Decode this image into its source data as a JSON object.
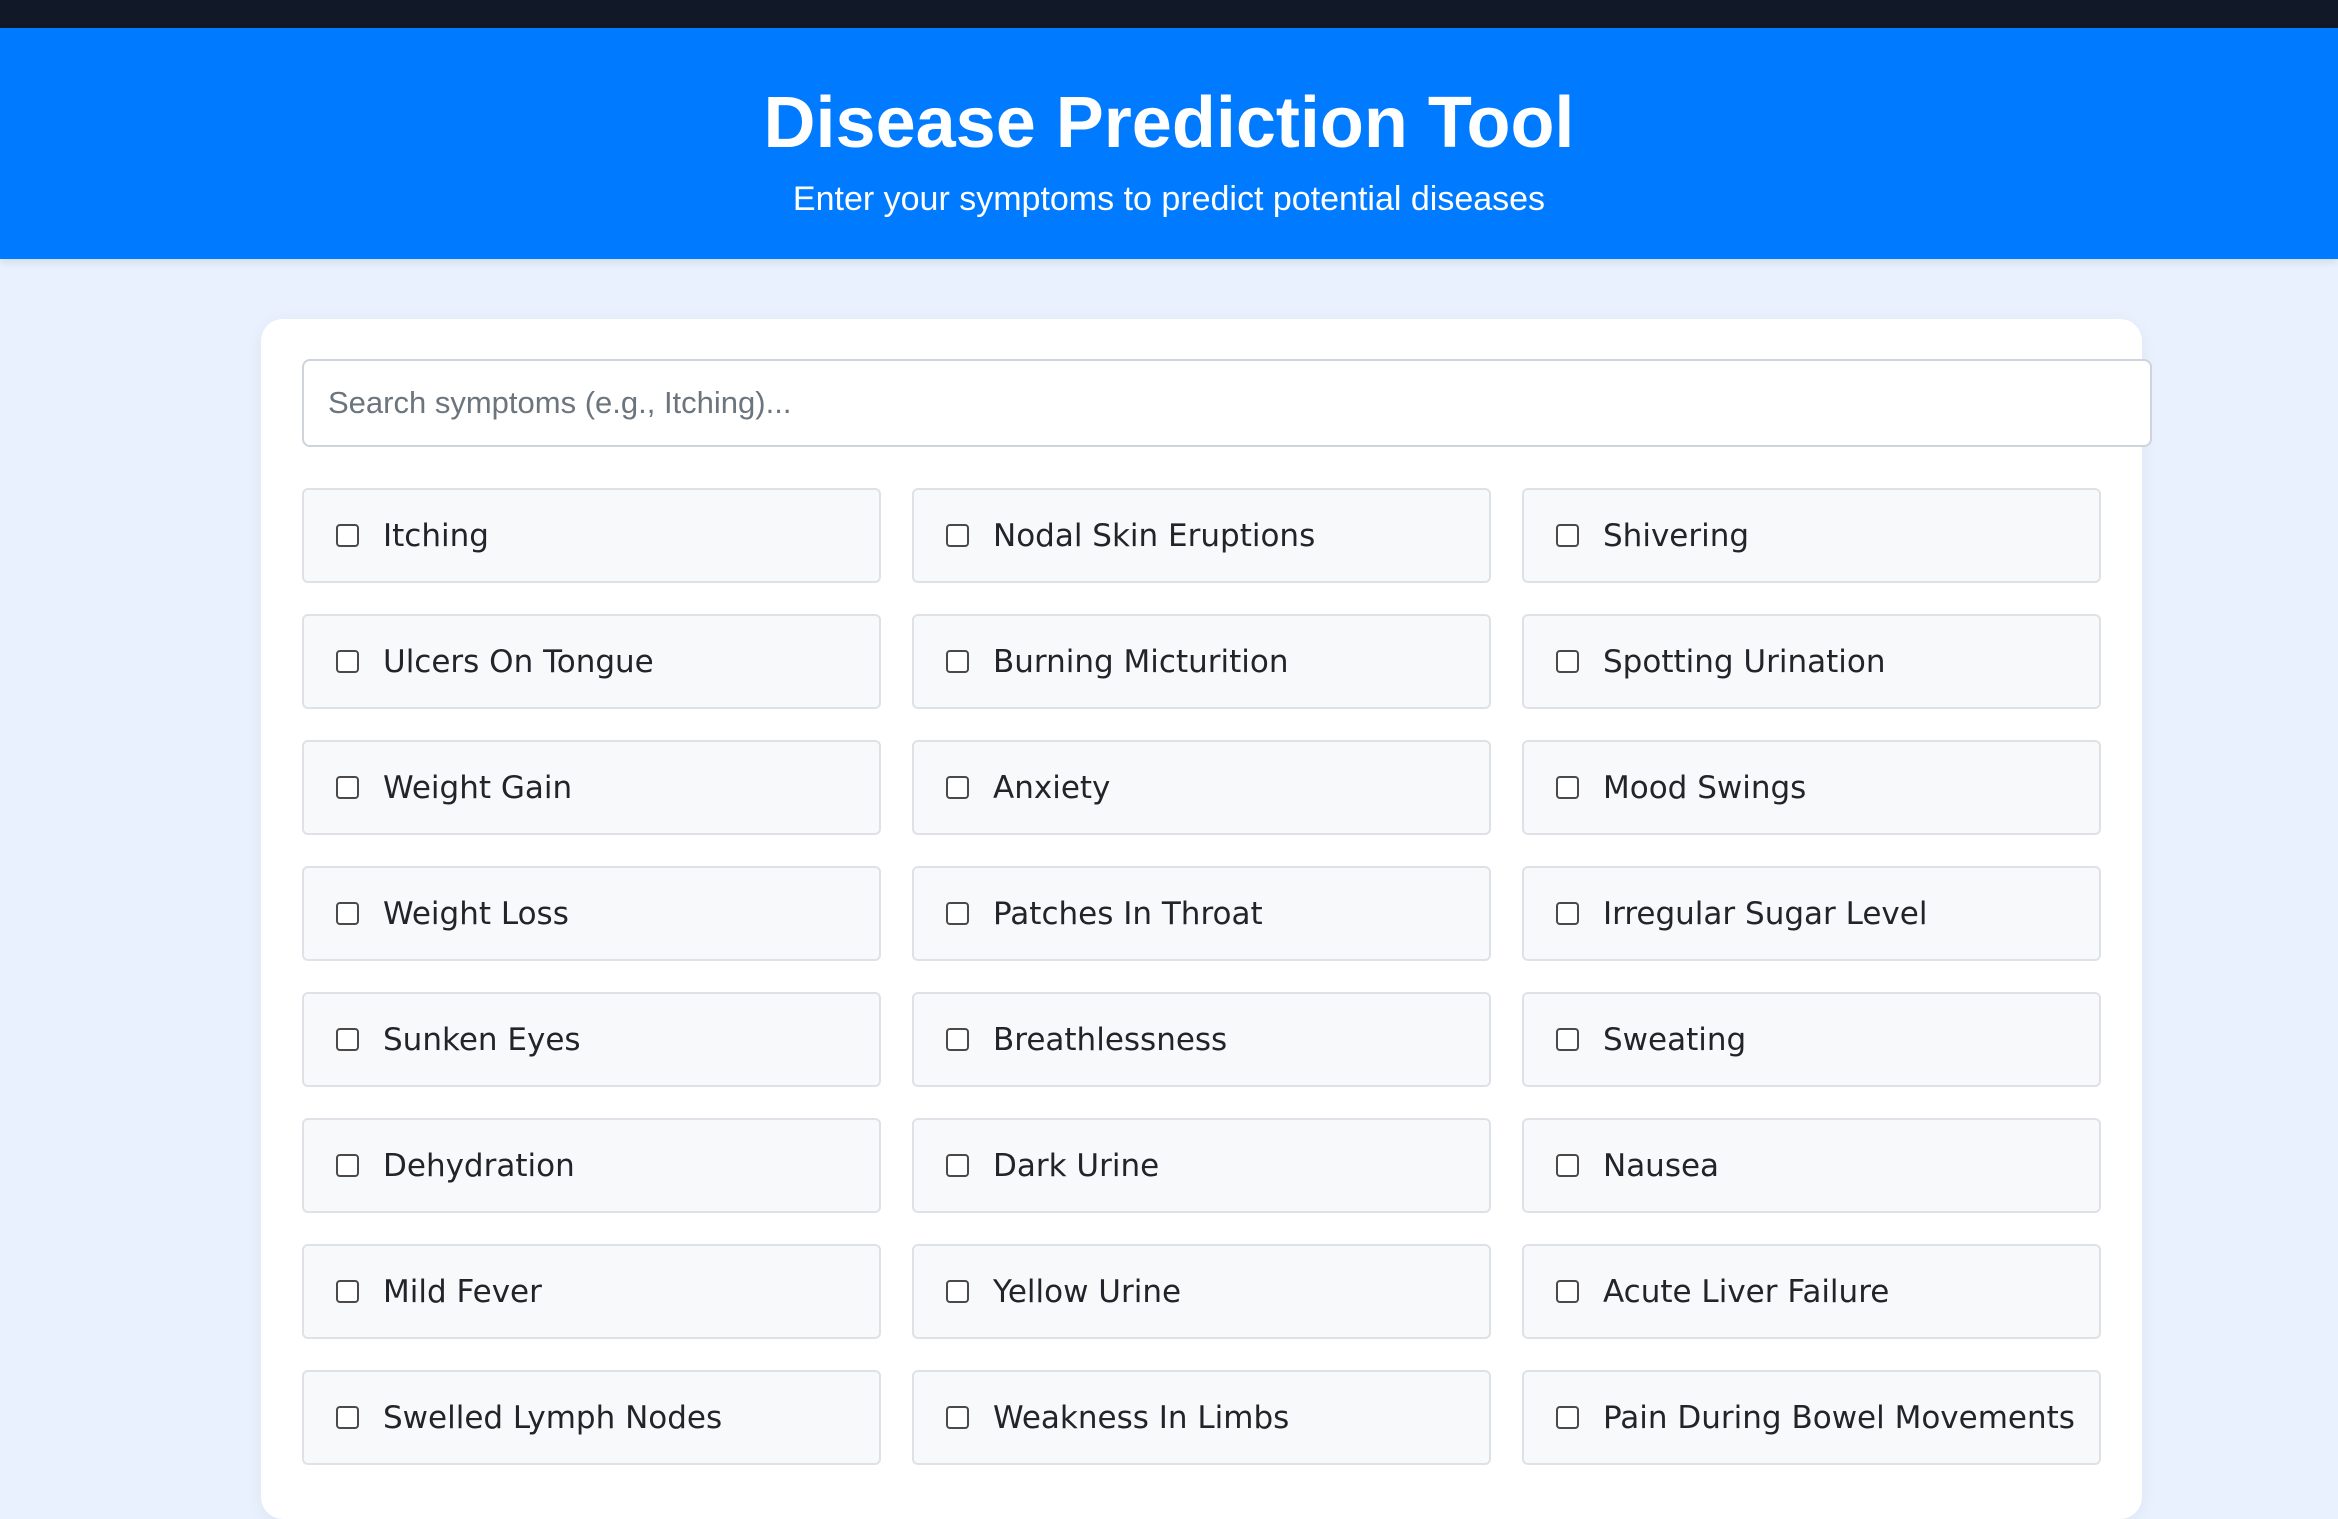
{
  "header": {
    "title": "Disease Prediction Tool",
    "subtitle": "Enter your symptoms to predict potential diseases"
  },
  "search": {
    "placeholder": "Search symptoms (e.g., Itching)...",
    "value": ""
  },
  "symptoms": [
    {
      "label": "Itching",
      "checked": false
    },
    {
      "label": "Nodal Skin Eruptions",
      "checked": false
    },
    {
      "label": "Shivering",
      "checked": false
    },
    {
      "label": "Ulcers On Tongue",
      "checked": false
    },
    {
      "label": "Burning Micturition",
      "checked": false
    },
    {
      "label": "Spotting Urination",
      "checked": false
    },
    {
      "label": "Weight Gain",
      "checked": false
    },
    {
      "label": "Anxiety",
      "checked": false
    },
    {
      "label": "Mood Swings",
      "checked": false
    },
    {
      "label": "Weight Loss",
      "checked": false
    },
    {
      "label": "Patches In Throat",
      "checked": false
    },
    {
      "label": "Irregular Sugar Level",
      "checked": false
    },
    {
      "label": "Sunken Eyes",
      "checked": false
    },
    {
      "label": "Breathlessness",
      "checked": false
    },
    {
      "label": "Sweating",
      "checked": false
    },
    {
      "label": "Dehydration",
      "checked": false
    },
    {
      "label": "Dark Urine",
      "checked": false
    },
    {
      "label": "Nausea",
      "checked": false
    },
    {
      "label": "Mild Fever",
      "checked": false
    },
    {
      "label": "Yellow Urine",
      "checked": false
    },
    {
      "label": "Acute Liver Failure",
      "checked": false
    },
    {
      "label": "Swelled Lymph Nodes",
      "checked": false
    },
    {
      "label": "Weakness In Limbs",
      "checked": false
    },
    {
      "label": "Pain During Bowel Movements",
      "checked": false
    }
  ],
  "colors": {
    "header_bg": "#007bff",
    "topbar_bg": "#111827",
    "page_bg": "#e8f1fd",
    "item_bg": "#f8f9fa"
  }
}
